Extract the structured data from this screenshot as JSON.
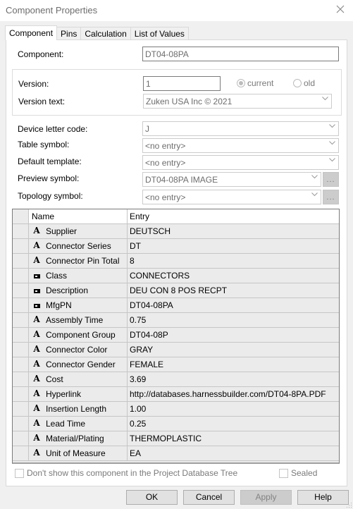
{
  "window": {
    "title": "Component Properties",
    "close_icon": "close-icon"
  },
  "tabs": [
    {
      "label": "Component",
      "active": true
    },
    {
      "label": "Pins",
      "active": false
    },
    {
      "label": "Calculation",
      "active": false
    },
    {
      "label": "List of Values",
      "active": false
    }
  ],
  "component": {
    "label": "Component:",
    "value": "DT04-08PA"
  },
  "version": {
    "label": "Version:",
    "value": "1",
    "radio_current": "current",
    "radio_old": "old",
    "selected": "current",
    "text_label": "Version text:",
    "text_value": "Zuken USA Inc © 2021"
  },
  "fields": {
    "device_letter_code": {
      "label": "Device letter code:",
      "value": "J"
    },
    "table_symbol": {
      "label": "Table symbol:",
      "value": "<no entry>"
    },
    "default_template": {
      "label": "Default template:",
      "value": "<no entry>"
    },
    "preview_symbol": {
      "label": "Preview symbol:",
      "value": "DT04-08PA IMAGE",
      "button": "..."
    },
    "topology_symbol": {
      "label": "Topology symbol:",
      "value": "<no entry>",
      "button": "..."
    }
  },
  "grid": {
    "headers": {
      "name": "Name",
      "entry": "Entry"
    },
    "rows": [
      {
        "icon": "attribute-icon",
        "name": "Supplier",
        "entry": "DEUTSCH"
      },
      {
        "icon": "attribute-icon",
        "name": "Connector Series",
        "entry": "DT"
      },
      {
        "icon": "attribute-icon",
        "name": "Connector Pin Total",
        "entry": "8"
      },
      {
        "icon": "database-field-icon",
        "name": "Class",
        "entry": "CONNECTORS"
      },
      {
        "icon": "database-field-icon",
        "name": "Description",
        "entry": "DEU CON 8 POS RECPT"
      },
      {
        "icon": "database-field-icon",
        "name": "MfgPN",
        "entry": "DT04-08PA"
      },
      {
        "icon": "attribute-icon",
        "name": "Assembly Time",
        "entry": "0.75"
      },
      {
        "icon": "attribute-icon",
        "name": "Component Group",
        "entry": "DT04-08P"
      },
      {
        "icon": "attribute-icon",
        "name": "Connector Color",
        "entry": "GRAY"
      },
      {
        "icon": "attribute-icon",
        "name": "Connector Gender",
        "entry": "FEMALE"
      },
      {
        "icon": "attribute-icon",
        "name": "Cost",
        "entry": "3.69"
      },
      {
        "icon": "attribute-icon",
        "name": "Hyperlink",
        "entry": "http://databases.harnessbuilder.com/DT04-8PA.PDF"
      },
      {
        "icon": "attribute-icon",
        "name": "Insertion Length",
        "entry": "1.00"
      },
      {
        "icon": "attribute-icon",
        "name": "Lead Time",
        "entry": "0.25"
      },
      {
        "icon": "attribute-icon",
        "name": "Material/Plating",
        "entry": "THERMOPLASTIC"
      },
      {
        "icon": "attribute-icon",
        "name": "Unit of Measure",
        "entry": "EA"
      }
    ]
  },
  "checkboxes": {
    "dont_show": {
      "label": "Don't show this component in the Project Database Tree",
      "checked": false
    },
    "sealed": {
      "label": "Sealed",
      "checked": false
    }
  },
  "buttons": {
    "ok": "OK",
    "cancel": "Cancel",
    "apply": "Apply",
    "help": "Help"
  }
}
